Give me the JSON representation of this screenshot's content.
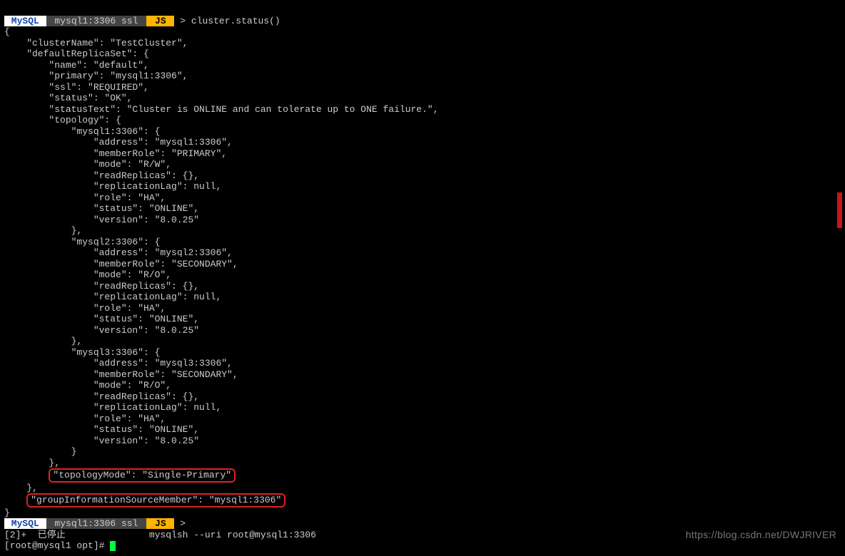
{
  "prompt1": {
    "mysql": " MySQL ",
    "host": " mysql1:3306 ssl ",
    "js": " JS ",
    "chevron": ">",
    "command": "cluster.status()"
  },
  "output": {
    "l0": "{",
    "l1": "    \"clusterName\": \"TestCluster\",",
    "l2": "    \"defaultReplicaSet\": {",
    "l3": "        \"name\": \"default\",",
    "l4": "        \"primary\": \"mysql1:3306\",",
    "l5": "        \"ssl\": \"REQUIRED\",",
    "l6": "        \"status\": \"OK\",",
    "l7": "        \"statusText\": \"Cluster is ONLINE and can tolerate up to ONE failure.\",",
    "l8": "        \"topology\": {",
    "l9": "            \"mysql1:3306\": {",
    "l10": "                \"address\": \"mysql1:3306\",",
    "l11": "                \"memberRole\": \"PRIMARY\",",
    "l12": "                \"mode\": \"R/W\",",
    "l13": "                \"readReplicas\": {},",
    "l14": "                \"replicationLag\": null,",
    "l15": "                \"role\": \"HA\",",
    "l16": "                \"status\": \"ONLINE\",",
    "l17": "                \"version\": \"8.0.25\"",
    "l18": "            },",
    "l19": "            \"mysql2:3306\": {",
    "l20": "                \"address\": \"mysql2:3306\",",
    "l21": "                \"memberRole\": \"SECONDARY\",",
    "l22": "                \"mode\": \"R/O\",",
    "l23": "                \"readReplicas\": {},",
    "l24": "                \"replicationLag\": null,",
    "l25": "                \"role\": \"HA\",",
    "l26": "                \"status\": \"ONLINE\",",
    "l27": "                \"version\": \"8.0.25\"",
    "l28": "            },",
    "l29": "            \"mysql3:3306\": {",
    "l30": "                \"address\": \"mysql3:3306\",",
    "l31": "                \"memberRole\": \"SECONDARY\",",
    "l32": "                \"mode\": \"R/O\",",
    "l33": "                \"readReplicas\": {},",
    "l34": "                \"replicationLag\": null,",
    "l35": "                \"role\": \"HA\",",
    "l36": "                \"status\": \"ONLINE\",",
    "l37": "                \"version\": \"8.0.25\"",
    "l38": "            }",
    "l39": "        },",
    "hl1": "\"topologyMode\": \"Single-Primary\"",
    "l40": "    },",
    "hl2": "\"groupInformationSourceMember\": \"mysql1:3306\"",
    "l41": "}"
  },
  "prompt2": {
    "mysql": " MySQL ",
    "host": " mysql1:3306 ssl ",
    "js": " JS ",
    "chevron": ">"
  },
  "stopped": "[2]+  已停止               mysqlsh --uri root@mysql1:3306",
  "rootprompt": "[root@mysql1 opt]# ",
  "watermark": "https://blog.csdn.net/DWJRIVER"
}
